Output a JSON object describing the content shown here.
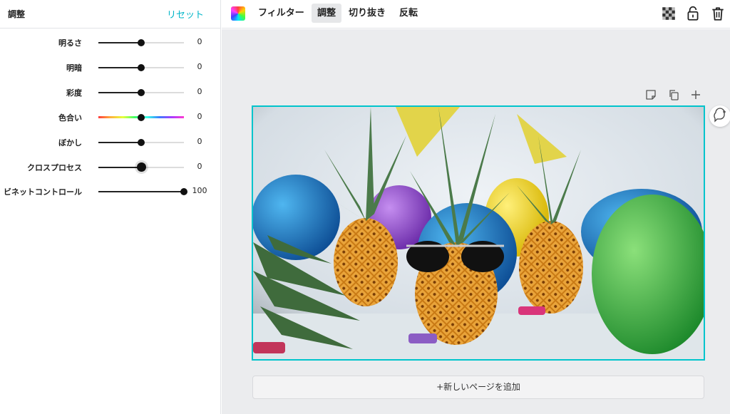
{
  "left_panel": {
    "title": "調整",
    "reset_label": "リセット",
    "sliders": [
      {
        "label": "明るさ",
        "value": "0",
        "level": 0.5
      },
      {
        "label": "明暗",
        "value": "0",
        "level": 0.5
      },
      {
        "label": "彩度",
        "value": "0",
        "level": 0.5
      },
      {
        "label": "色合い",
        "value": "0",
        "level": 0.5
      },
      {
        "label": "ぼかし",
        "value": "0",
        "level": 0.5
      },
      {
        "label": "クロスプロセス",
        "value": "0",
        "level": 0.5
      },
      {
        "label": "ビネットコントロール",
        "value": "100",
        "level": 1.0
      }
    ]
  },
  "toolbar": {
    "filter_label": "フィルター",
    "adjust_label": "調整",
    "crop_label": "切り抜き",
    "flip_label": "反転"
  },
  "canvas": {
    "add_page_label": "+新しいページを追加"
  },
  "colors": {
    "accent": "#00c4cc",
    "reset_link": "#00b5c8",
    "canvas_bg": "#ebecee"
  },
  "icons": {
    "color_swatch": "color-picker-icon",
    "transparency": "transparency-icon",
    "lock": "lock-icon",
    "trash": "trash-icon",
    "note": "note-icon",
    "duplicate": "duplicate-icon",
    "add": "plus-icon",
    "comment": "comment-add-icon"
  }
}
